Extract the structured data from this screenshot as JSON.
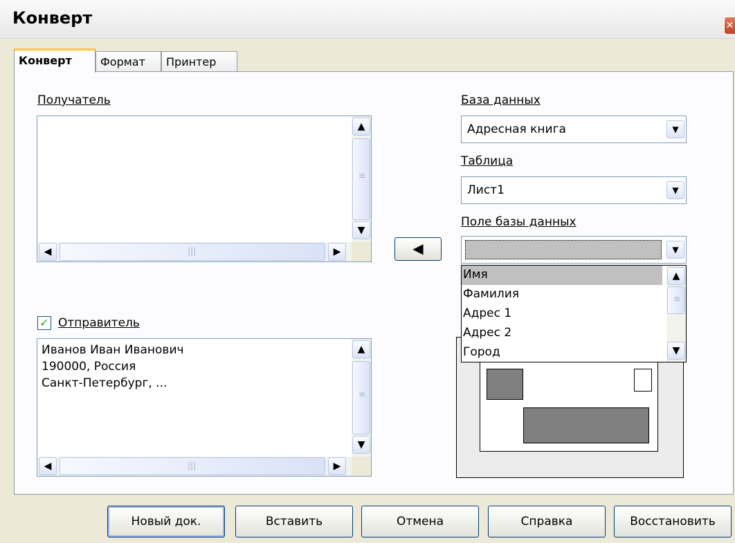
{
  "window": {
    "title": "Конверт",
    "close_glyph": "✕"
  },
  "tabs": [
    {
      "label": "Конверт",
      "active": true
    },
    {
      "label": "Формат",
      "active": false
    },
    {
      "label": "Принтер",
      "active": false
    }
  ],
  "recipient": {
    "label": "Получатель",
    "value": ""
  },
  "sender": {
    "label": "Отправитель",
    "checked": true,
    "lines": [
      "Иванов Иван Иванович",
      "190000, Россия",
      "Санкт-Петербург, ..."
    ]
  },
  "database": {
    "label": "База данных",
    "value": "Адресная книга"
  },
  "table": {
    "label": "Таблица",
    "value": "Лист1"
  },
  "db_field": {
    "label": "Поле базы данных",
    "value": "",
    "options": [
      "Имя",
      "Фамилия",
      "Адрес 1",
      "Адрес 2",
      "Город"
    ],
    "selected_index": 0
  },
  "insert_arrow": {
    "icon": "arrow-left-icon"
  },
  "buttons": {
    "new_doc": "Новый док.",
    "insert": "Вставить",
    "cancel": "Отмена",
    "help": "Справка",
    "reset": "Восстановить"
  },
  "colors": {
    "tab_accent": "#ffc73c",
    "window_bg": "#ece9d8",
    "preview_block": "#808080"
  }
}
